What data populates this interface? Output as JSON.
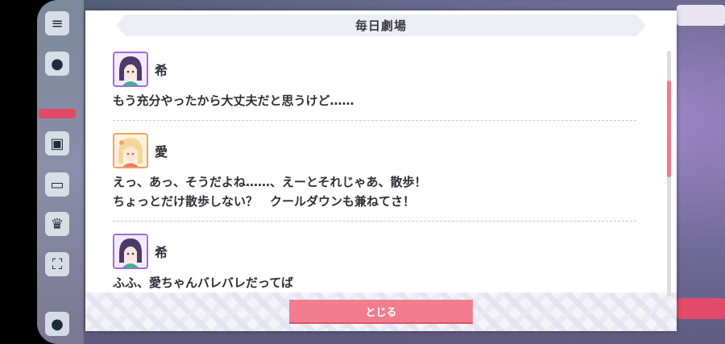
{
  "dialog": {
    "title": "毎日劇場",
    "close_label": "とじる",
    "entries": [
      {
        "speaker": "希",
        "avatar": "nozomi-avatar",
        "lines": [
          "もう充分やったから大丈夫だと思うけど……"
        ]
      },
      {
        "speaker": "愛",
        "avatar": "ai-avatar",
        "lines": [
          "えっ、あっ、そうだよね……、えーとそれじゃあ、散歩！",
          "ちょっとだけ散歩しない？　クールダウンも兼ねてさ！"
        ]
      },
      {
        "speaker": "希",
        "avatar": "nozomi-avatar",
        "lines": [
          "ふふ、愛ちゃんバレバレだってば"
        ]
      }
    ]
  },
  "colors": {
    "accent": "#f27d8e",
    "scroll_thumb": "#f07893",
    "nozomi_frame": "#a56bd6",
    "ai_frame": "#f1a163"
  },
  "scroll": {
    "position_fraction": 0.2
  }
}
